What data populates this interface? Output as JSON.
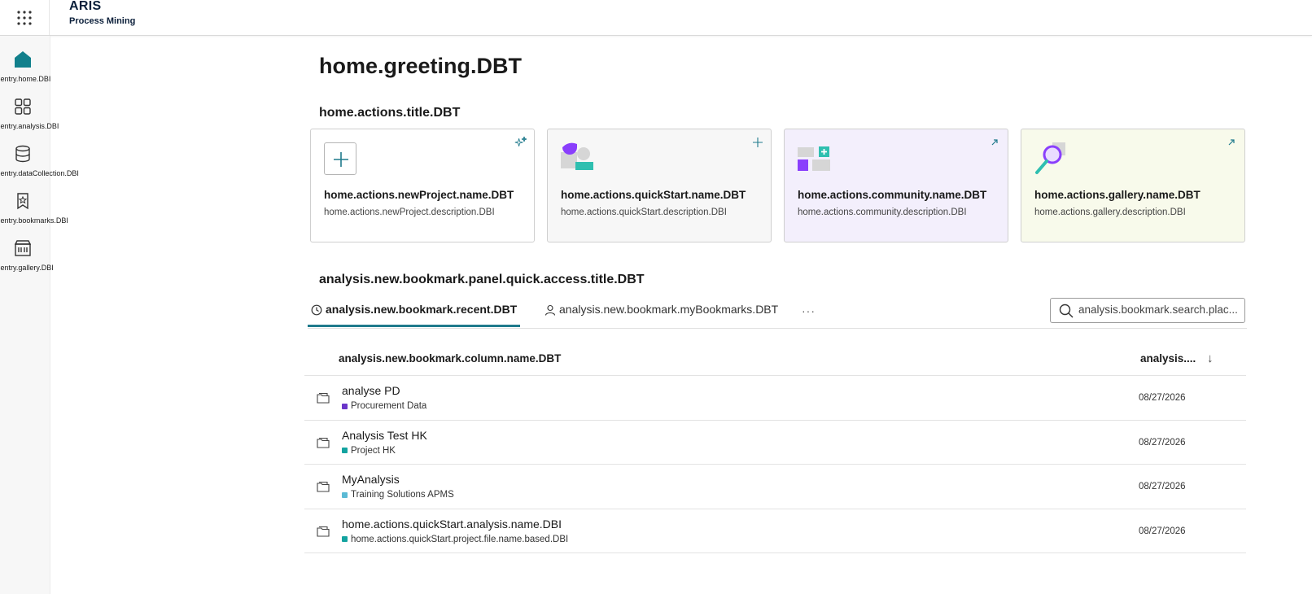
{
  "header": {
    "brand_name": "ARIS",
    "brand_sub": "Process Mining",
    "app_menu_icon": "grid-dots-icon"
  },
  "sidebar": {
    "items": [
      {
        "label": "navigation.entry.home.DBI",
        "icon": "home-icon",
        "active": true
      },
      {
        "label": "navigation.entry.analysis.DBI",
        "icon": "grid-icon"
      },
      {
        "label": "navigation.entry.dataCollection.DBI",
        "icon": "database-icon"
      },
      {
        "label": "navigation.entry.bookmarks.DBI",
        "icon": "bookmark-star-icon"
      },
      {
        "label": "navigation.entry.gallery.DBI",
        "icon": "gallery-icon"
      }
    ]
  },
  "main": {
    "greeting": "home.greeting.DBT",
    "actions_title": "home.actions.title.DBT",
    "cards": [
      {
        "title": "home.actions.newProject.name.DBT",
        "description": "home.actions.newProject.description.DBI",
        "bg": "#ffffff",
        "corner_icon": "sparkle-icon"
      },
      {
        "title": "home.actions.quickStart.name.DBT",
        "description": "home.actions.quickStart.description.DBI",
        "bg": "#f7f7f7",
        "corner_icon": "plus-icon"
      },
      {
        "title": "home.actions.community.name.DBT",
        "description": "home.actions.community.description.DBI",
        "bg": "#f3effc",
        "corner_icon": "external-arrow-icon"
      },
      {
        "title": "home.actions.gallery.name.DBT",
        "description": "home.actions.gallery.description.DBI",
        "bg": "#f8faeb",
        "corner_icon": "external-arrow-icon"
      }
    ],
    "bookmarks_title": "analysis.new.bookmark.panel.quick.access.title.DBT",
    "tabs": [
      {
        "label": "analysis.new.bookmark.recent.DBT",
        "icon": "clock-icon",
        "active": true
      },
      {
        "label": "analysis.new.bookmark.myBookmarks.DBT",
        "icon": "user-icon",
        "active": false
      }
    ],
    "more_label": "···",
    "search": {
      "placeholder": "analysis.bookmark.search.plac..."
    },
    "table": {
      "col_name": "analysis.new.bookmark.column.name.DBT",
      "col_date": "analysis....",
      "sort_icon": "↓",
      "rows": [
        {
          "name": "analyse PD",
          "project": "Procurement Data",
          "color": "#6a35c9",
          "date": "08/27/2026"
        },
        {
          "name": "Analysis Test HK",
          "project": "Project HK",
          "color": "#13a3a0",
          "date": "08/27/2026"
        },
        {
          "name": "MyAnalysis",
          "project": "Training Solutions APMS",
          "color": "#5bbad5",
          "date": "08/27/2026"
        },
        {
          "name": "home.actions.quickStart.analysis.name.DBI",
          "project": "home.actions.quickStart.project.file.name.based.DBI",
          "color": "#13a3a0",
          "date": "08/27/2026"
        }
      ]
    }
  },
  "colors": {
    "accent": "#1f7a8c",
    "home_icon": "#12808c",
    "teal": "#2fbfb0",
    "purple": "#8a3ffc"
  }
}
